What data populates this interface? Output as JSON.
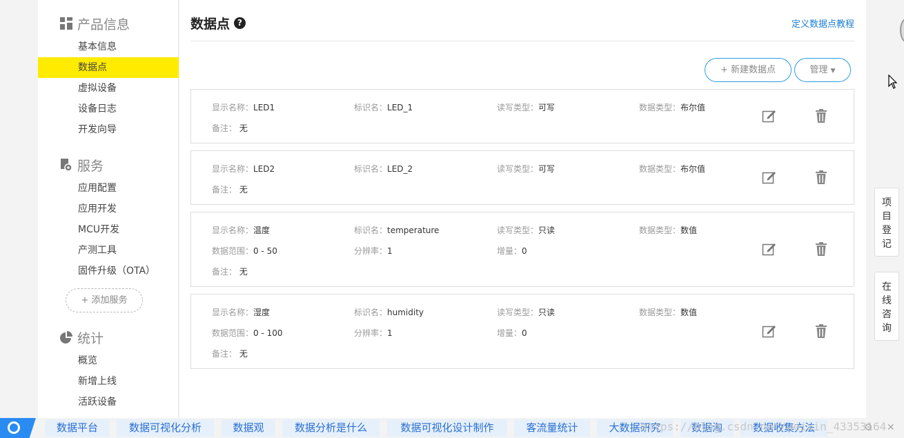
{
  "sidebar": {
    "sections": [
      {
        "title": "产品信息",
        "icon": "grid-icon"
      },
      {
        "title": "服务",
        "icon": "service-gear-icon"
      },
      {
        "title": "统计",
        "icon": "pie-chart-icon"
      }
    ],
    "items": [
      "基本信息",
      "数据点",
      "虚拟设备",
      "设备日志",
      "开发向导",
      "应用配置",
      "应用开发",
      "MCU开发",
      "产测工具",
      "固件升级（OTA）",
      "概览",
      "新增上线",
      "活跃设备"
    ],
    "add_service": "+ 添加服务"
  },
  "header": {
    "title": "数据点",
    "help": "?",
    "tutorial_link": "定义数据点教程"
  },
  "toolbar": {
    "new_label": "+ 新建数据点",
    "manage_label": "管理"
  },
  "labels": {
    "display_name": "显示名称：",
    "identifier": "标识名：",
    "rw_type": "读写类型：",
    "data_type": "数据类型：",
    "range": "数据范围：",
    "resolution": "分辨率：",
    "increment": "增量：",
    "remark": "备注："
  },
  "datapoints": [
    {
      "name": "LED1",
      "id": "LED_1",
      "rw": "可写",
      "type": "布尔值",
      "remark": "无"
    },
    {
      "name": "LED2",
      "id": "LED_2",
      "rw": "可写",
      "type": "布尔值",
      "remark": "无"
    },
    {
      "name": "温度",
      "id": "temperature",
      "rw": "只读",
      "type": "数值",
      "range": "0 - 50",
      "resolution": "1",
      "increment": "0",
      "remark": "无"
    },
    {
      "name": "湿度",
      "id": "humidity",
      "rw": "只读",
      "type": "数值",
      "range": "0 - 100",
      "resolution": "1",
      "increment": "0",
      "remark": "无"
    }
  ],
  "right_tabs": [
    "项目登记",
    "在线咨询"
  ],
  "bottom_bar": {
    "keywords": [
      "数据平台",
      "数据可视化分析",
      "数据观",
      "数据分析是什么",
      "数据可视化设计制作",
      "客流量统计",
      "大数据研究",
      "数据淘",
      "数据收集方法"
    ],
    "watermark": "https://blog.csdn.net/weixin_43353164"
  },
  "colors": {
    "active_nav": "#ffeb00",
    "link": "#1a7fd4",
    "button_border": "#2b9be0",
    "keyword_bg": "#e6f0fb"
  }
}
